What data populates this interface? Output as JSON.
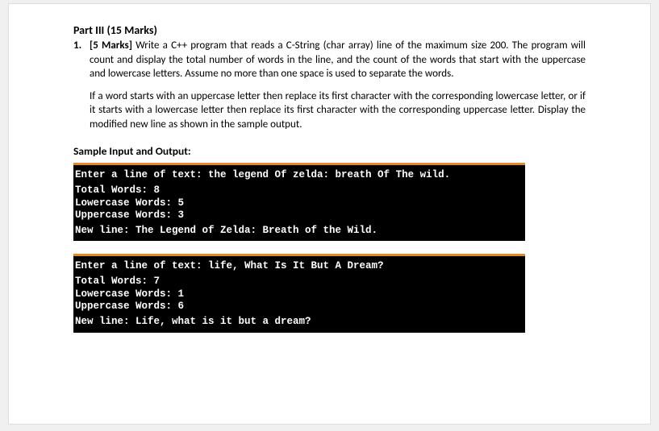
{
  "heading": "Part III (15 Marks)",
  "question": {
    "number": "1.",
    "marks": "[5 Marks]",
    "para1": " Write a C++ program that reads a C-String (char array) line of the maximum size 200. The program will count and display the total number of words in the line, and the count of the words that start with the uppercase and lowercase letters. Assume no more than one space is used to separate the words.",
    "para2": "If a word starts with an uppercase letter then replace its first character with the corresponding lowercase letter, or if it starts with a lowercase letter then replace its first character with the corresponding uppercase letter. Display the modified new line as shown in the sample output."
  },
  "sampleHeading": "Sample Input and Output:",
  "terminal1": {
    "l1": "Enter a line of text: the legend Of zelda: breath Of The wild.",
    "l2": "Total Words: 8",
    "l3": "Lowercase Words: 5",
    "l4": "Uppercase Words: 3",
    "l5": "New line: The Legend of Zelda: Breath of the Wild."
  },
  "terminal2": {
    "l1": "Enter a line of text: life, What Is It But A Dream?",
    "l2": "Total Words: 7",
    "l3": "Lowercase Words: 1",
    "l4": "Uppercase Words: 6",
    "l5": "New line: Life, what is it but a dream?"
  }
}
